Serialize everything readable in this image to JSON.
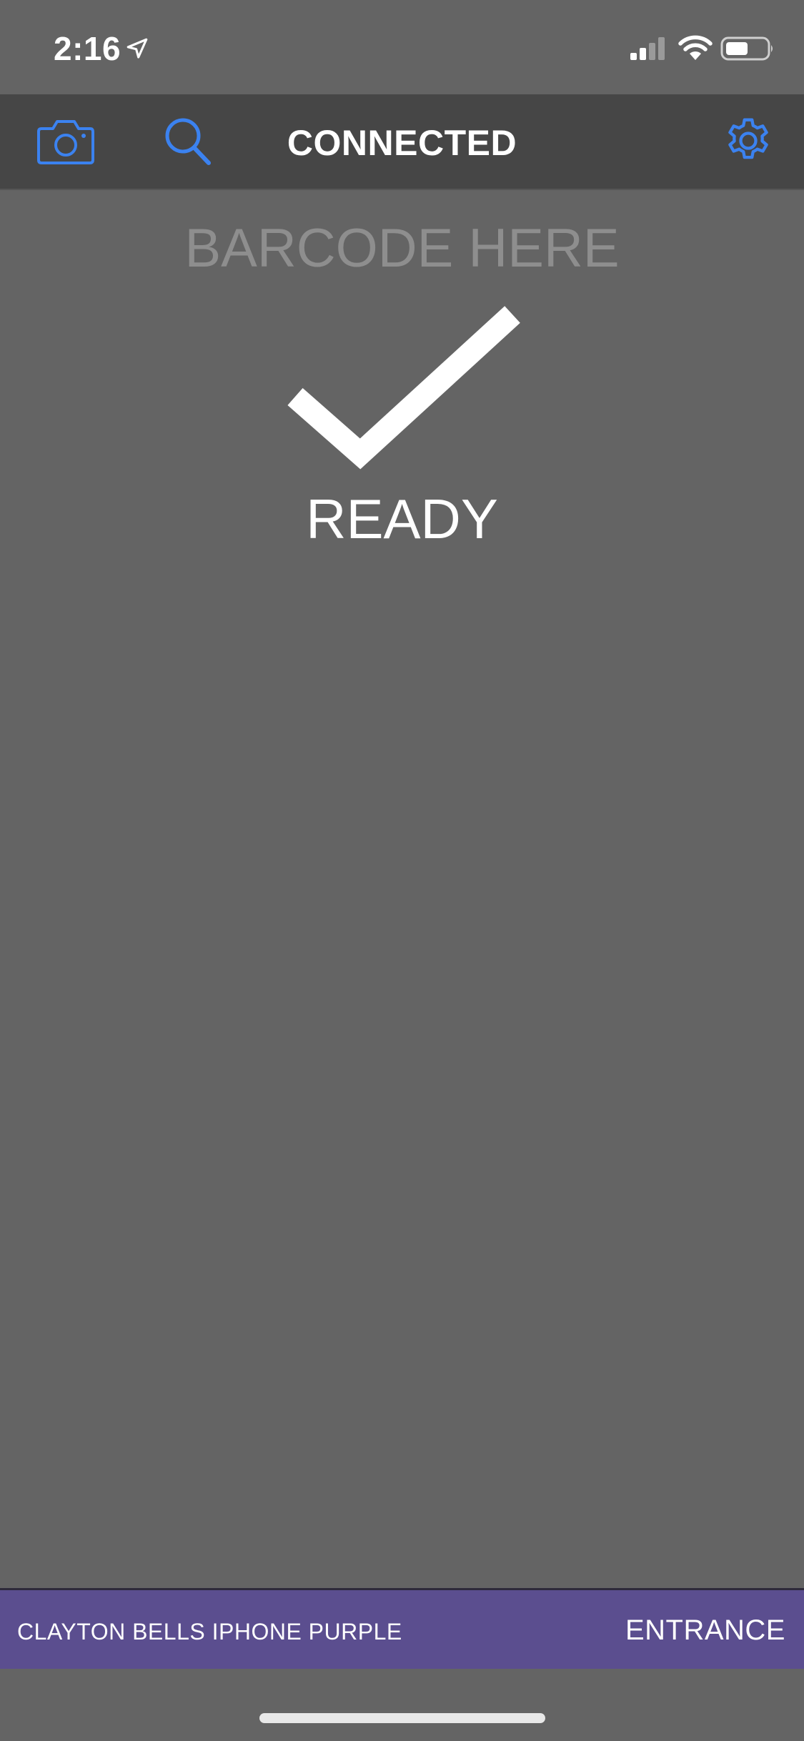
{
  "status_bar": {
    "time": "2:16",
    "icons": [
      "location-arrow-icon",
      "cellular-signal-icon",
      "wifi-icon",
      "battery-icon"
    ]
  },
  "toolbar": {
    "title": "CONNECTED",
    "left_icons": [
      "camera-icon",
      "search-icon"
    ],
    "right_icons": [
      "gear-icon"
    ],
    "accent_color": "#3b82f0"
  },
  "main": {
    "barcode_placeholder": "BARCODE HERE",
    "barcode_value": "",
    "status_icon": "checkmark-icon",
    "status_text": "READY"
  },
  "info_bar": {
    "device_name": "CLAYTON BELLS IPHONE PURPLE",
    "station": "ENTRANCE",
    "background_color": "#5b4e8f"
  },
  "colors": {
    "background": "#646464",
    "toolbar": "#464646",
    "accent": "#3b82f0",
    "placeholder": "#8e8e8e"
  }
}
